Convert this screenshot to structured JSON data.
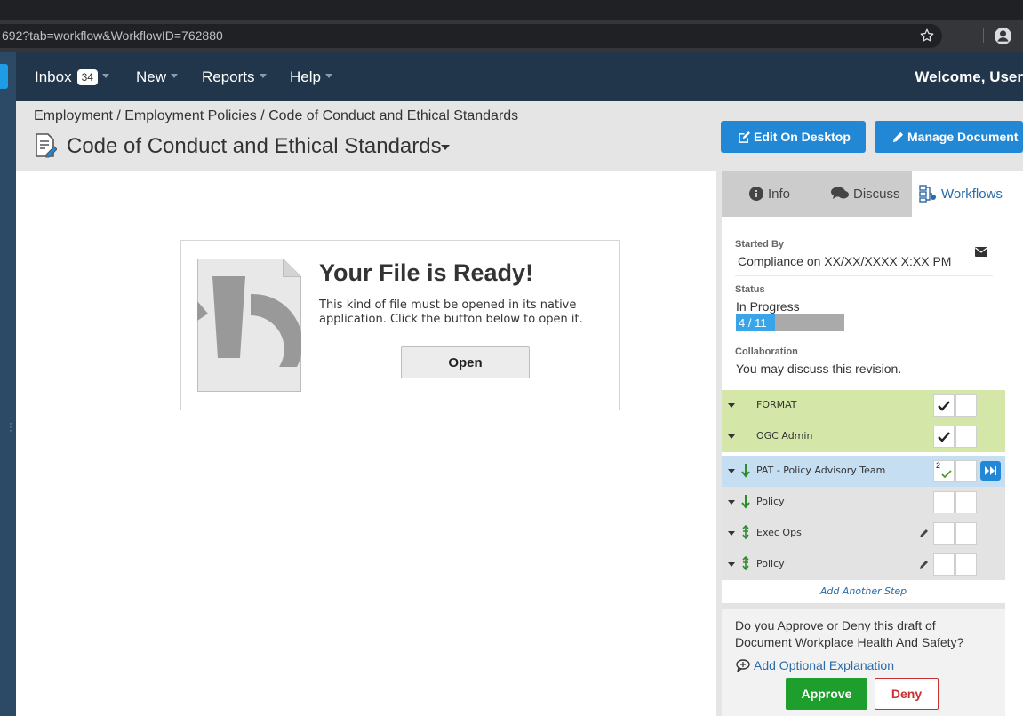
{
  "browser": {
    "url": "692?tab=workflow&WorkflowID=762880"
  },
  "nav": {
    "inbox_label": "Inbox",
    "inbox_count": "34",
    "new_label": "New",
    "reports_label": "Reports",
    "help_label": "Help",
    "welcome": "Welcome, User"
  },
  "header": {
    "breadcrumb": "Employment / Employment Policies / Code of Conduct and Ethical Standards",
    "title": "Code of Conduct and Ethical Standards",
    "edit_button": "Edit On Desktop",
    "manage_button": "Manage Document"
  },
  "file_panel": {
    "heading": "Your File is Ready!",
    "description": "This kind of file must be opened in its native application. Click the button below to open it.",
    "open_button": "Open"
  },
  "side_tabs": {
    "info": "Info",
    "discuss": "Discuss",
    "workflows": "Workflows"
  },
  "workflow": {
    "started_by_label": "Started By",
    "started_by": "Compliance on XX/XX/XXXX X:XX PM",
    "status_label": "Status",
    "status": "In Progress",
    "progress_text": "4 / 11",
    "progress_fraction": 0.3636,
    "collaboration_label": "Collaboration",
    "collaboration": "You may discuss this revision.",
    "steps": [
      {
        "name": "FORMAT",
        "state": "complete"
      },
      {
        "name": "OGC Admin",
        "state": "complete"
      },
      {
        "name": "PAT - Policy Advisory Team",
        "state": "current",
        "count": "2"
      },
      {
        "name": "Policy",
        "state": "pending"
      },
      {
        "name": "Exec Ops",
        "state": "pending"
      },
      {
        "name": "Policy",
        "state": "pending"
      }
    ],
    "add_step": "Add Another Step",
    "approve_question": "Do you Approve or Deny this draft of Document Workplace Health And Safety?",
    "explain_link": "Add Optional Explanation",
    "approve_button": "Approve",
    "deny_button": "Deny"
  },
  "colors": {
    "nav_bg": "#22364b",
    "accent_blue": "#2288d6",
    "complete_row": "#d4e6a8",
    "current_row": "#c6def2",
    "pending_row": "#e3e3e3",
    "approve": "#1e9e2c",
    "deny": "#c93030"
  }
}
